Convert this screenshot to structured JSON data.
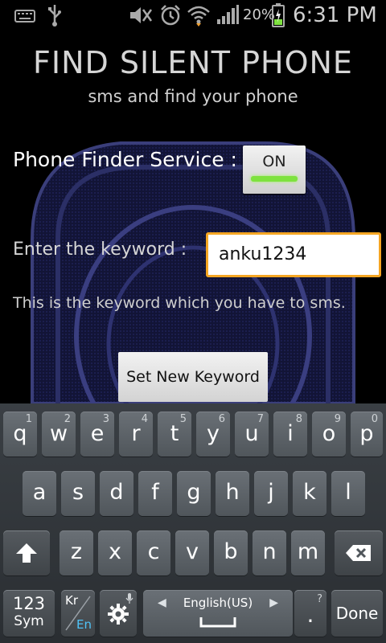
{
  "status_bar": {
    "time": "6:31 PM",
    "battery_percent": "20%",
    "icons": [
      "keyboard-icon",
      "usb-icon",
      "mute-icon",
      "alarm-icon",
      "wifi-icon",
      "signal-icon",
      "battery-charging-icon"
    ]
  },
  "app": {
    "title": "FIND SILENT PHONE",
    "subtitle": "sms and find your phone",
    "service_label": "Phone Finder Service :",
    "toggle_state": "ON",
    "keyword_label": "Enter the keyword :",
    "keyword_value": "anku1234",
    "hint": "This is the keyword which you have to sms.",
    "set_button": "Set New Keyword"
  },
  "keyboard": {
    "row1": [
      {
        "ch": "q",
        "sub": "1"
      },
      {
        "ch": "w",
        "sub": "2"
      },
      {
        "ch": "e",
        "sub": "3"
      },
      {
        "ch": "r",
        "sub": "4"
      },
      {
        "ch": "t",
        "sub": "5"
      },
      {
        "ch": "y",
        "sub": "6"
      },
      {
        "ch": "u",
        "sub": "7"
      },
      {
        "ch": "i",
        "sub": "8"
      },
      {
        "ch": "o",
        "sub": "9"
      },
      {
        "ch": "p",
        "sub": "0"
      }
    ],
    "row2": [
      "a",
      "s",
      "d",
      "f",
      "g",
      "h",
      "j",
      "k",
      "l"
    ],
    "row3": [
      "z",
      "x",
      "c",
      "v",
      "b",
      "n",
      "m"
    ],
    "sym_top": "123",
    "sym_bottom": "Sym",
    "lang_top": "Kr",
    "lang_bottom": "En",
    "space_label": "English(US)",
    "period": ".",
    "period_sub": "?",
    "done": "Done"
  }
}
